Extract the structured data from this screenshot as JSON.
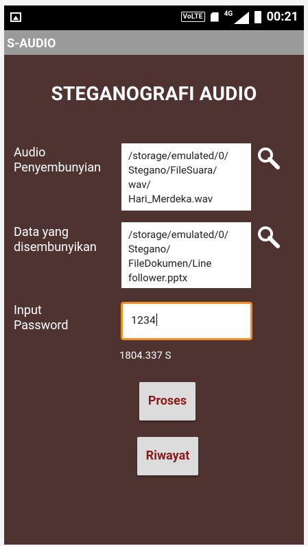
{
  "status_bar": {
    "left_icon": "image-icon",
    "volte": "VoLTE",
    "network": "4G",
    "time": "00:21"
  },
  "app": {
    "title": "S-AUDIO"
  },
  "main": {
    "heading": "STEGANOGRAFI AUDIO",
    "audio_label": "Audio\nPenyembunyian",
    "audio_path": "/storage/emulated/0/\nStegano/FileSuara/\nwav/\nHari_Merdeka.wav",
    "data_label": "Data yang\ndisembunyikan",
    "data_path": "/storage/emulated/0/\nStegano/\nFileDokumen/Line\nfollower.pptx",
    "password_label": "Input\nPassword",
    "password_value": "1234",
    "duration": "1804.337 S",
    "process_button": "Proses",
    "history_button": "Riwayat"
  },
  "colors": {
    "background": "#4e3331",
    "focus_border": "#f28b23",
    "button_text": "#8b1a1a"
  }
}
